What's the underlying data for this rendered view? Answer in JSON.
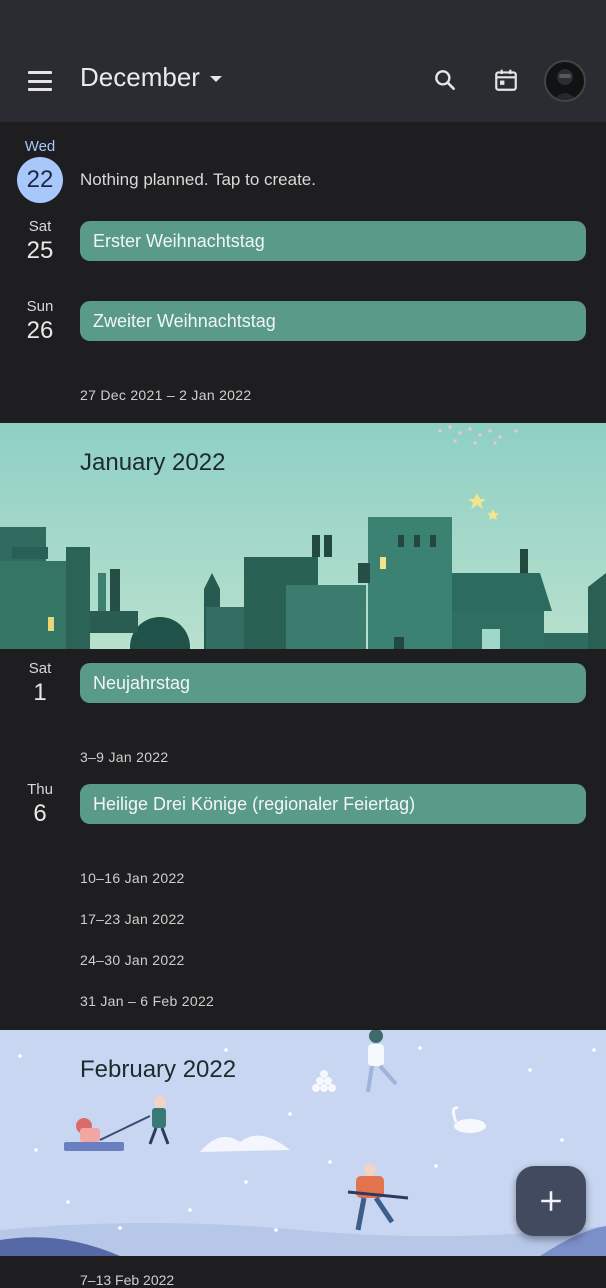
{
  "header": {
    "month_label": "December",
    "icons": [
      "menu-icon",
      "search-icon",
      "calendar-today-icon",
      "avatar"
    ]
  },
  "today": {
    "dow": "Wed",
    "num": "22",
    "empty_text": "Nothing planned. Tap to create."
  },
  "days": [
    {
      "dow": "Sat",
      "num": "25",
      "event": "Erster Weihnachtstag"
    },
    {
      "dow": "Sun",
      "num": "26",
      "event": "Zweiter Weihnachtstag"
    },
    {
      "dow": "Sat",
      "num": "1",
      "event": "Neujahrstag"
    },
    {
      "dow": "Thu",
      "num": "6",
      "event": "Heilige Drei Könige (regionaler Feiertag)"
    }
  ],
  "weeks": [
    "27 Dec 2021 – 2 Jan 2022",
    "3–9 Jan 2022",
    "10–16 Jan 2022",
    "17–23 Jan 2022",
    "24–30 Jan 2022",
    "31 Jan – 6 Feb 2022"
  ],
  "banners": {
    "january": "January 2022",
    "february": "February 2022"
  },
  "partial_week": "7–13 Feb 2022",
  "colors": {
    "event": "#5a9a88",
    "today_circle": "#a8c7fa",
    "topbar": "#2a2c31",
    "background": "#1e1e20",
    "fab": "#414a5f"
  }
}
